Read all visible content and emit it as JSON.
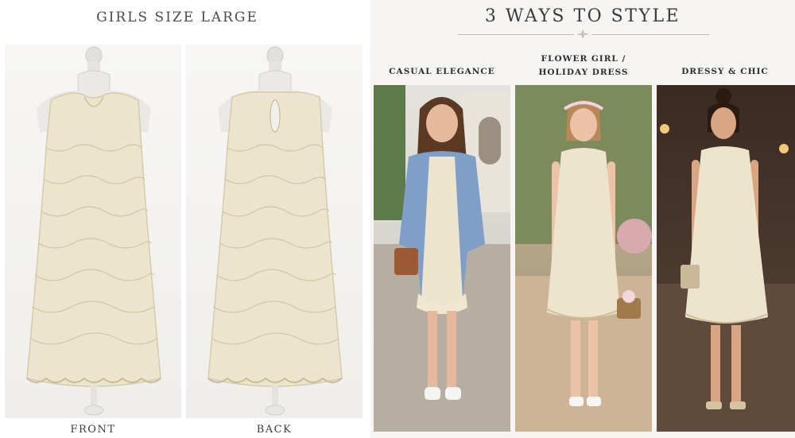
{
  "left": {
    "title": "GIRLS SIZE LARGE",
    "front_label": "FRONT",
    "back_label": "BACK"
  },
  "right": {
    "title": "3 WAYS TO STYLE",
    "styles": [
      {
        "label_line1": "CASUAL ELEGANCE",
        "label_line2": ""
      },
      {
        "label_line1": "FLOWER GIRL /",
        "label_line2": "HOLIDAY DRESS"
      },
      {
        "label_line1": "DRESSY & CHIC",
        "label_line2": ""
      }
    ]
  },
  "colors": {
    "dress": "#ece4cc",
    "dress_shadow": "#d9cfb2",
    "denim": "#7f9fc8",
    "accent_text": "#3a3a3a"
  }
}
